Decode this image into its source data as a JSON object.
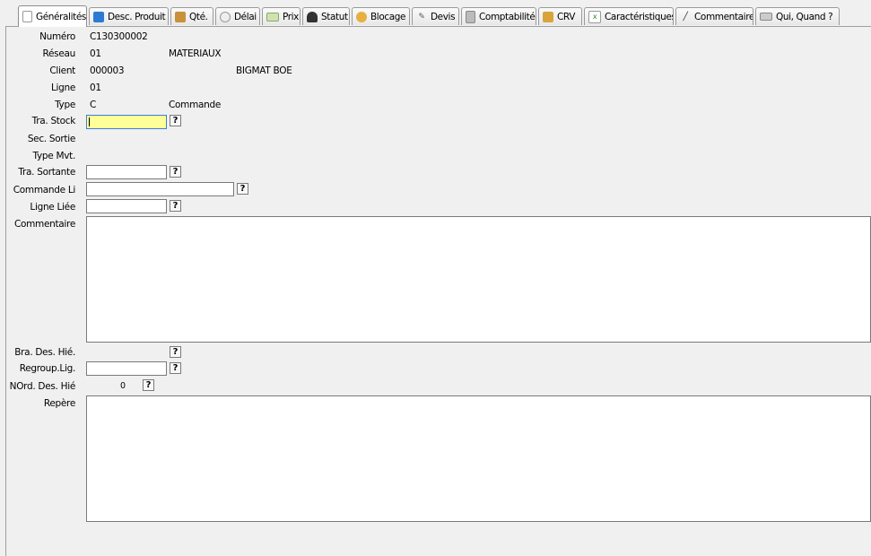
{
  "tabs": [
    {
      "label": "Généralités",
      "icon": "document-icon"
    },
    {
      "label": "Desc. Produit",
      "icon": "books-icon"
    },
    {
      "label": "Qté.",
      "icon": "box-icon"
    },
    {
      "label": "Délai",
      "icon": "clock-icon"
    },
    {
      "label": "Prix",
      "icon": "money-icon"
    },
    {
      "label": "Statut",
      "icon": "person-icon"
    },
    {
      "label": "Blocage",
      "icon": "stop-icon"
    },
    {
      "label": "Devis",
      "icon": "pencil-ruler-icon"
    },
    {
      "label": "Comptabilité",
      "icon": "calculator-icon"
    },
    {
      "label": "CRV",
      "icon": "clipboard-icon"
    },
    {
      "label": "Caractéristiques",
      "icon": "sheet-icon"
    },
    {
      "label": "Commentaire",
      "icon": "pen-icon"
    },
    {
      "label": "Qui, Quand ?",
      "icon": "keyboard-icon"
    }
  ],
  "form": {
    "numero": {
      "label": "Numéro",
      "value": "C130300002"
    },
    "reseau": {
      "label": "Réseau",
      "value": "01",
      "desc": "MATERIAUX"
    },
    "client": {
      "label": "Client",
      "value": "000003",
      "desc": "BIGMAT BOE"
    },
    "ligne": {
      "label": "Ligne",
      "value": "01"
    },
    "type": {
      "label": "Type",
      "value": "C",
      "desc": "Commande"
    },
    "tra_stock": {
      "label": "Tra. Stock",
      "value": ""
    },
    "sec_sortie": {
      "label": "Sec. Sortie"
    },
    "type_mvt": {
      "label": "Type Mvt."
    },
    "tra_sortante": {
      "label": "Tra. Sortante",
      "value": ""
    },
    "commande_li": {
      "label": "Commande Li",
      "value": ""
    },
    "ligne_liee": {
      "label": "Ligne Liée",
      "value": ""
    },
    "commentaire": {
      "label": "Commentaire",
      "value": ""
    },
    "bra_des_hie": {
      "label": "Bra. Des. Hié."
    },
    "regroup_lig": {
      "label": "Regroup.Lig.",
      "value": ""
    },
    "nord_des_hie": {
      "label": "NOrd. Des. Hié",
      "value": "0"
    },
    "repere": {
      "label": "Repère",
      "value": ""
    },
    "help_symbol": "?"
  }
}
